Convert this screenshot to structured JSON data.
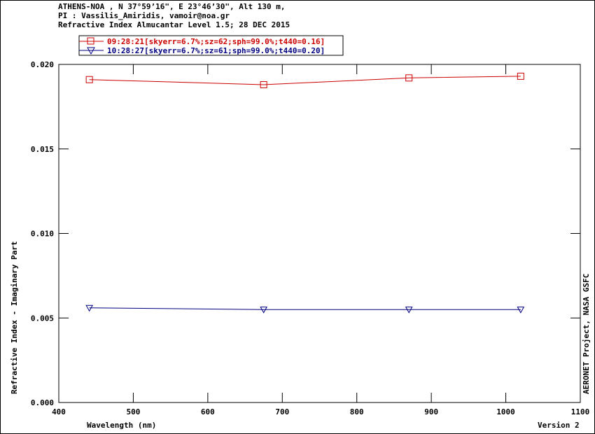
{
  "header": {
    "line1": "ATHENS-NOA , N 37°59’16\", E 23°46’30\", Alt 130 m,",
    "line2": "PI : Vassilis_Amiridis, vamoir@noa.gr",
    "line3": "Refractive Index Almucantar Level 1.5; 28 DEC 2015"
  },
  "footer": {
    "version": "Version 2",
    "credit": "AERONET Project, NASA GSFC"
  },
  "colors": {
    "series1": "#cc0000",
    "series2": "#000080",
    "axis": "#000000"
  },
  "chart_data": {
    "type": "line",
    "xlabel": "Wavelength (nm)",
    "ylabel": "Refractive Index - Imaginary Part",
    "xlim": [
      400,
      1100
    ],
    "ylim": [
      0.0,
      0.02
    ],
    "xticks": [
      400,
      500,
      600,
      700,
      800,
      900,
      1000,
      1100
    ],
    "yticks": [
      0.0,
      0.005,
      0.01,
      0.015,
      0.02
    ],
    "ytick_labels": [
      "0.000",
      "0.005",
      "0.010",
      "0.015",
      "0.020"
    ],
    "grid": false,
    "legend_position": "top-left",
    "series": [
      {
        "name": "09:28:21[skyerr=6.7%;sz=62;sph=99.0%;t440=0.16]",
        "marker": "square",
        "color": "#cc0000",
        "x": [
          441,
          675,
          870,
          1020
        ],
        "y": [
          0.0191,
          0.0188,
          0.0192,
          0.0193
        ]
      },
      {
        "name": "10:28:27[skyerr=6.7%;sz=61;sph=99.0%;t440=0.20]",
        "marker": "triangle-down",
        "color": "#000080",
        "x": [
          441,
          675,
          870,
          1020
        ],
        "y": [
          0.0056,
          0.0055,
          0.0055,
          0.0055
        ]
      }
    ]
  }
}
